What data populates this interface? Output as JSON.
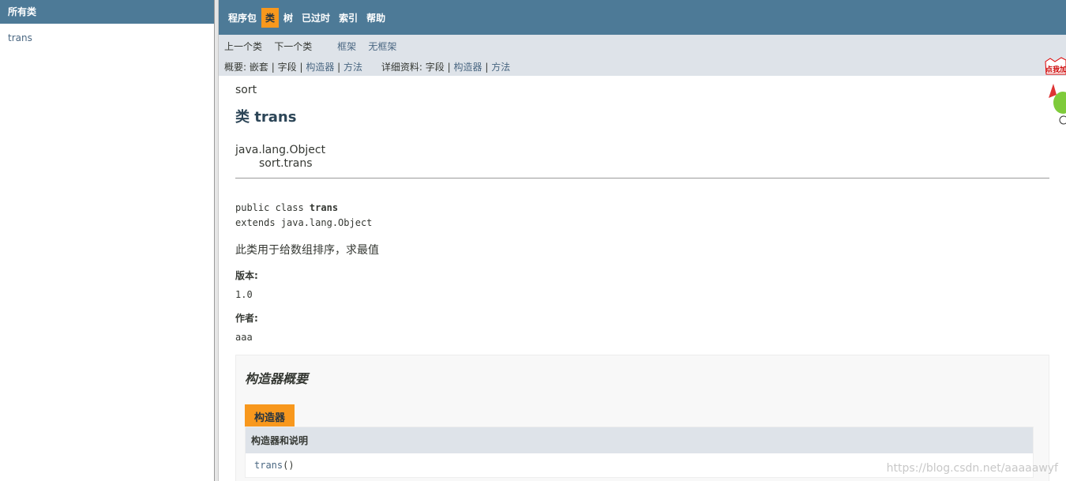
{
  "left": {
    "header": "所有类",
    "items": [
      "trans"
    ]
  },
  "nav": {
    "items": [
      "程序包",
      "类",
      "树",
      "已过时",
      "索引",
      "帮助"
    ],
    "active_index": 1
  },
  "subnav": {
    "prev_class": "上一个类",
    "next_class": "下一个类",
    "frames": "框架",
    "no_frames": "无框架",
    "summary_label": "概要:",
    "summary_nested": "嵌套",
    "summary_field": "字段",
    "summary_constructor": "构造器",
    "summary_method": "方法",
    "detail_label": "详细资料:",
    "detail_field": "字段",
    "detail_constructor": "构造器",
    "detail_method": "方法",
    "sep": "|"
  },
  "content": {
    "package": "sort",
    "title": "类 trans",
    "inherit_root": "java.lang.Object",
    "inherit_child": "sort.trans",
    "sig_prefix": "public class ",
    "sig_name": "trans",
    "sig_extends": "extends java.lang.Object",
    "description": "此类用于给数组排序，求最值",
    "version_label": "版本:",
    "version_value": "1.0",
    "author_label": "作者:",
    "author_value": "aaa"
  },
  "constructor_summary": {
    "heading": "构造器概要",
    "tab": "构造器",
    "column_header": "构造器和说明",
    "rows": [
      {
        "name": "trans",
        "suffix": "()"
      }
    ]
  },
  "widget": {
    "text": "点我加"
  },
  "watermark": "https://blog.csdn.net/aaaaawyf",
  "colors": {
    "header_bg": "#4d7a97",
    "subnav_bg": "#dee3e9",
    "active_tab": "#f8981d",
    "link": "#4a6782"
  }
}
